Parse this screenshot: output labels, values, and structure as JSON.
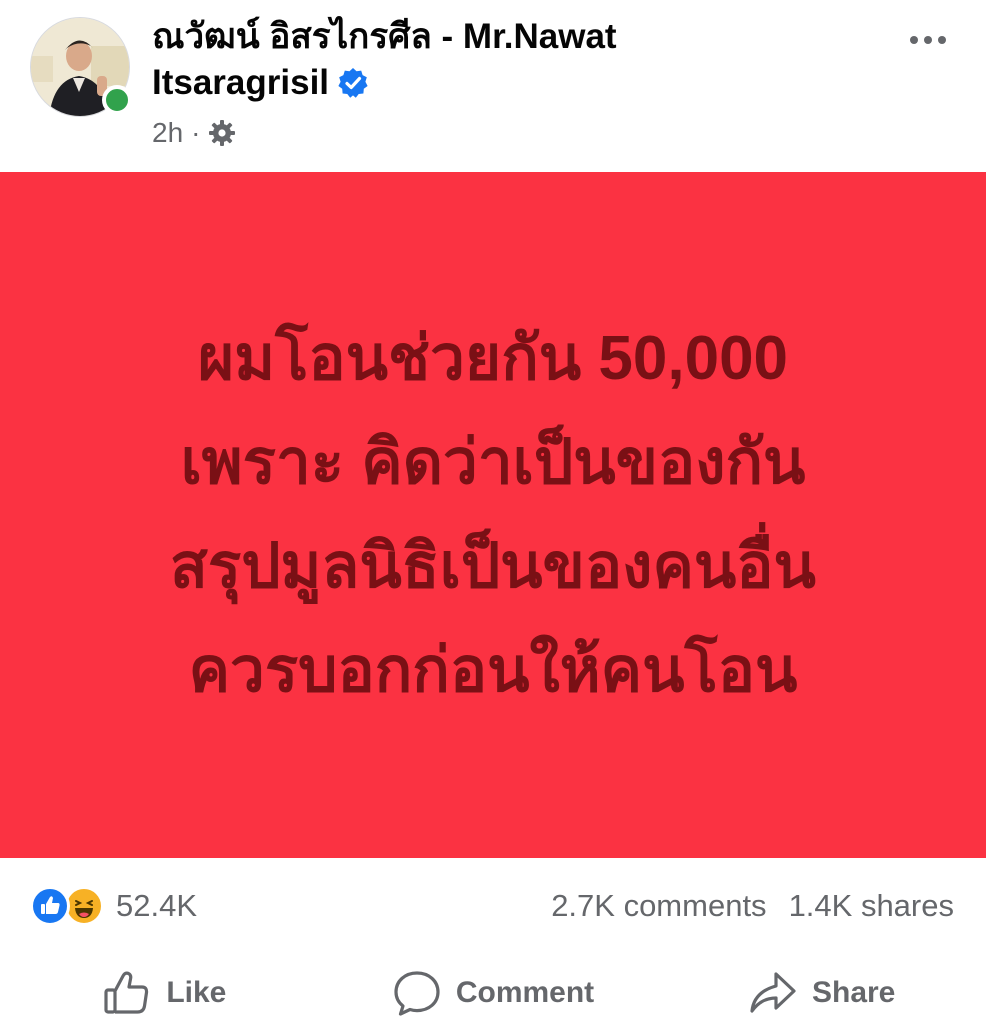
{
  "author": {
    "name_line1": "ณวัฒน์ อิสรไกรศีล - Mr.Nawat",
    "name_line2": "Itsaragrisil",
    "verified": true,
    "online": true
  },
  "post": {
    "time": "2h",
    "separator": "·",
    "privacy_icon": "gear-icon"
  },
  "image": {
    "background_color": "#fb3242",
    "text_color": "#7a1015",
    "lines": [
      "ผมโอนช่วยกัน 50,000",
      "เพราะ คิดว่าเป็นของกัน",
      "สรุปมูลนิธิเป็นของคนอื่น",
      "ควรบอกก่อนให้คนโอน"
    ]
  },
  "stats": {
    "reaction_icons": [
      "like-icon",
      "haha-icon"
    ],
    "reaction_count": "52.4K",
    "comments": "2.7K comments",
    "shares": "1.4K shares"
  },
  "actions": {
    "like": "Like",
    "comment": "Comment",
    "share": "Share"
  },
  "colors": {
    "accent_blue": "#1877f2",
    "online_green": "#31a24c",
    "muted_text": "#65676b"
  }
}
